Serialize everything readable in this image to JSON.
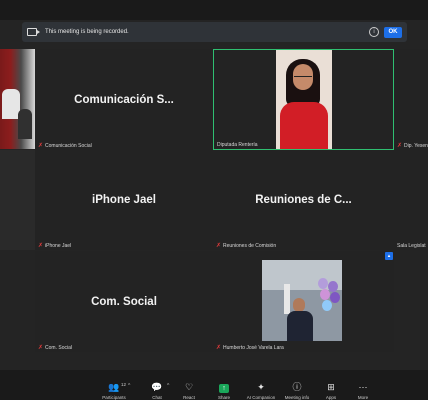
{
  "banner": {
    "message": "This meeting is being recorded.",
    "ok_label": "OK"
  },
  "tiles": {
    "comunicacion": {
      "display": "Comunicación  S...",
      "name": "Comunicación Social"
    },
    "diputada": {
      "name": "Diputada Rentería"
    },
    "dip_right": {
      "name": "Dip. Yesen"
    },
    "iphone": {
      "display": "iPhone Jael",
      "name": "iPhone Jael"
    },
    "reuniones": {
      "display": "Reuniones  de  C...",
      "name": "Reuniones de Comisión"
    },
    "sala": {
      "name": "Sala Legislat"
    },
    "comsocial": {
      "display": "Com. Social",
      "name": "Com. Social"
    },
    "humberto": {
      "name": "Humberto José Varela Lara"
    }
  },
  "toolbar": {
    "participants": {
      "label": "Participants",
      "count": "12"
    },
    "chat": {
      "label": "Chat"
    },
    "react": {
      "label": "React"
    },
    "share": {
      "label": "Share"
    },
    "ai": {
      "label": "AI Companion"
    },
    "info": {
      "label": "Meeting info"
    },
    "apps": {
      "label": "Apps"
    },
    "more": {
      "label": "More"
    }
  },
  "colors": {
    "accent": "#1d6fe8",
    "active_border": "#2fbf71",
    "muted": "#e23b3b",
    "share": "#1aa75a"
  }
}
